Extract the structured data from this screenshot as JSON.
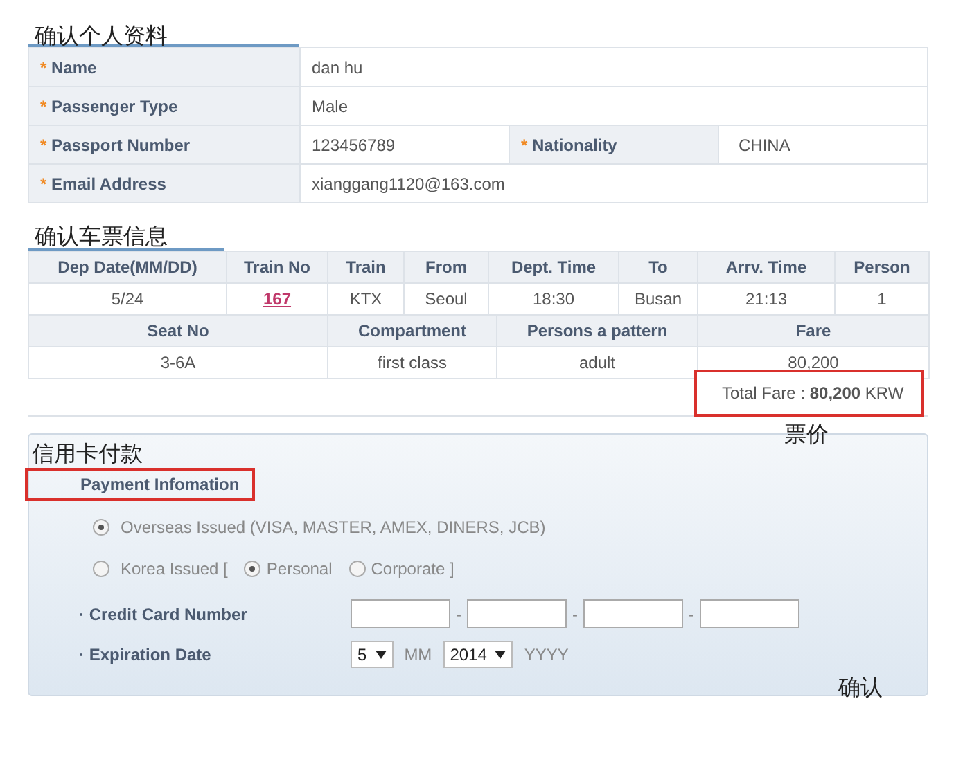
{
  "personal": {
    "heading": "确认个人资料",
    "fields": [
      {
        "marker": "*",
        "label": "Name",
        "value": "dan hu"
      },
      {
        "marker": "*",
        "label": "Passenger Type",
        "value": "Male"
      },
      {
        "marker": "*",
        "label": "Passport Number",
        "value": "123456789",
        "extra_marker": "*",
        "extra_label": "Nationality",
        "extra_value": "CHINA"
      },
      {
        "marker": "*",
        "label": "Email Address",
        "value": "xianggang1120@163.com"
      }
    ]
  },
  "ticket": {
    "heading": "确认车票信息",
    "columns": [
      "Dep Date(MM/DD)",
      "Train No",
      "Train",
      "From",
      "Dept. Time",
      "To",
      "Arrv. Time",
      "Person"
    ],
    "row": [
      "5/24",
      "167",
      "KTX",
      "Seoul",
      "18:30",
      "Busan",
      "21:13",
      "1"
    ],
    "columns_2": [
      "Seat No",
      "Compartment",
      "Persons a pattern",
      "Fare"
    ],
    "row_2": [
      "3-6A",
      "first class",
      "adult",
      "80,200"
    ],
    "total": "Total Fare : **80,200** KRW",
    "fare_note": "票价"
  },
  "payment": {
    "heading": "信用卡付款",
    "title": "Payment Infomation",
    "card_types": [
      {
        "label": "Overseas Issued (VISA, MASTER, AMEX, DINERS, JCB)",
        "selected": true
      },
      {
        "label": "Korea Issued [",
        "selected": false
      }
    ],
    "korea_options": [
      {
        "label": "Personal",
        "selected": true
      },
      {
        "label": "Corporate ]",
        "selected": false
      }
    ],
    "card_number_label": "· Credit Card Number",
    "separators": [
      "-",
      "-",
      "-"
    ],
    "expiry_label": "· Expiration Date",
    "month": "5",
    "month_unit": "MM",
    "year": "2014",
    "year_unit": "YYYY",
    "confirm_note": "确认"
  }
}
